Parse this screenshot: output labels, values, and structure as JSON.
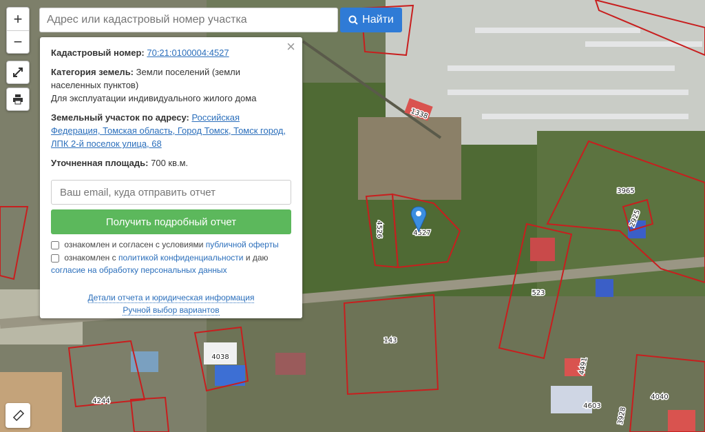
{
  "search": {
    "placeholder": "Адрес или кадастровый номер участка",
    "button_label": "Найти"
  },
  "map_controls": {
    "zoom_in": "+",
    "zoom_out": "−"
  },
  "parcel_labels": [
    "1338",
    "4526",
    "4527",
    "3965",
    "2925",
    "523",
    "143",
    "4038",
    "4244",
    "4491",
    "4603",
    "3928",
    "4040"
  ],
  "panel": {
    "cadastral_label": "Кадастровый номер:",
    "cadastral_value": "70:21:0100004:4527",
    "category_label": "Категория земель:",
    "category_value": "Земли поселений (земли населенных пунктов)",
    "usage": "Для эксплуатации индивидуального жилого дома",
    "address_label": "Земельный участок по адресу:",
    "address_value": "Российская Федерация, Томская область, Город Томск, Томск город, ЛПК 2-й поселок улица, 68",
    "area_label": "Уточненная площадь:",
    "area_value": "700 кв.м.",
    "email_placeholder": "Ваш email, куда отправить отчет",
    "report_button": "Получить подробный отчет",
    "consent1_prefix": "ознакомлен и согласен с условиями",
    "consent1_link": "публичной оферты",
    "consent2_prefix": "ознакомлен с",
    "consent2_link1": "политикой конфиденциальности",
    "consent2_mid": "и даю",
    "consent2_link2": "согласие на обработку персональных данных",
    "link_details": "Детали отчета и юридическая информация",
    "link_manual": "Ручной выбор вариантов"
  },
  "colors": {
    "parcel_border": "#c81e1e",
    "accent_blue": "#2f7bd6",
    "green_button": "#5cb85c"
  }
}
